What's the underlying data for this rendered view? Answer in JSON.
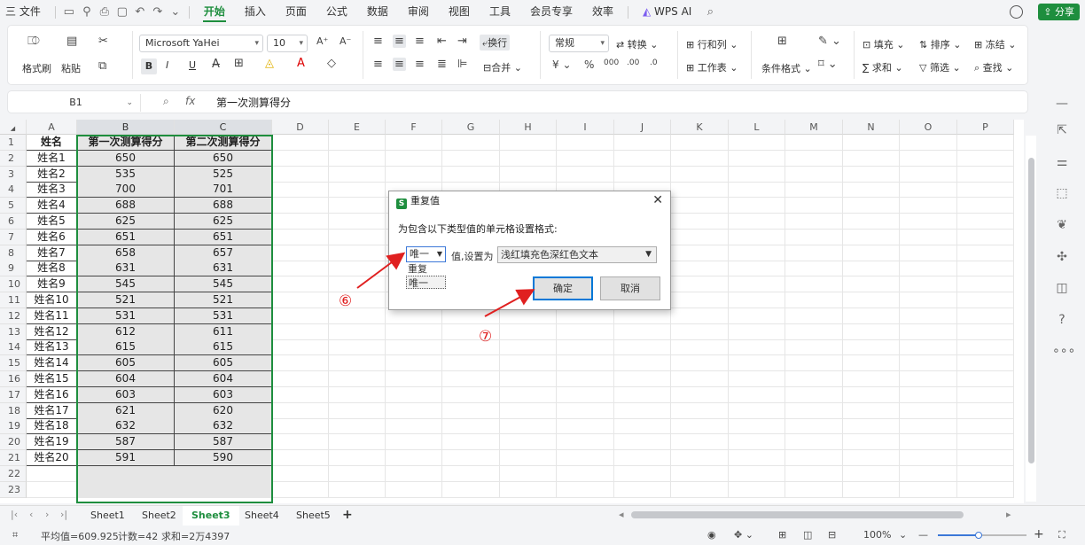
{
  "menu": {
    "items": [
      "三 文件",
      "开始",
      "插入",
      "页面",
      "公式",
      "数据",
      "审阅",
      "视图",
      "工具",
      "会员专享",
      "效率"
    ],
    "active_index": 1,
    "wps_ai": "WPS AI",
    "share": "分享"
  },
  "ribbon": {
    "format_painter": "格式刷",
    "paste": "粘贴",
    "font": "Microsoft YaHei",
    "font_size": "10",
    "bold": "B",
    "italic": "I",
    "underline": "U",
    "wrap": "换行",
    "number_format": "常规",
    "convert": "转换",
    "row_col": "行和列",
    "merge": "合并",
    "worksheet": "工作表",
    "cond_format": "条件格式",
    "fill": "填充",
    "sort": "排序",
    "freeze": "冻结",
    "sum": "求和",
    "filter": "筛选",
    "find": "查找"
  },
  "formula_bar": {
    "name_box": "B1",
    "fx": "fx",
    "content": "第一次测算得分"
  },
  "columns": [
    "A",
    "B",
    "C",
    "D",
    "E",
    "F",
    "G",
    "H",
    "I",
    "J",
    "K",
    "L",
    "M",
    "N",
    "O",
    "P"
  ],
  "rows": [
    [
      "姓名",
      "第一次测算得分",
      "第二次测算得分"
    ],
    [
      "姓名1",
      "650",
      "650"
    ],
    [
      "姓名2",
      "535",
      "525"
    ],
    [
      "姓名3",
      "700",
      "701"
    ],
    [
      "姓名4",
      "688",
      "688"
    ],
    [
      "姓名5",
      "625",
      "625"
    ],
    [
      "姓名6",
      "651",
      "651"
    ],
    [
      "姓名7",
      "658",
      "657"
    ],
    [
      "姓名8",
      "631",
      "631"
    ],
    [
      "姓名9",
      "545",
      "545"
    ],
    [
      "姓名10",
      "521",
      "521"
    ],
    [
      "姓名11",
      "531",
      "531"
    ],
    [
      "姓名12",
      "612",
      "611"
    ],
    [
      "姓名13",
      "615",
      "615"
    ],
    [
      "姓名14",
      "605",
      "605"
    ],
    [
      "姓名15",
      "604",
      "604"
    ],
    [
      "姓名16",
      "603",
      "603"
    ],
    [
      "姓名17",
      "621",
      "620"
    ],
    [
      "姓名18",
      "632",
      "632"
    ],
    [
      "姓名19",
      "587",
      "587"
    ],
    [
      "姓名20",
      "591",
      "590"
    ]
  ],
  "row_count": 23,
  "dialog": {
    "icon": "S",
    "title": "重复值",
    "close": "✕",
    "description": "为包含以下类型值的单元格设置格式:",
    "type_selected": "唯一",
    "type_options": [
      "重复",
      "唯一"
    ],
    "set_as_label": "值,设置为",
    "format_value": "浅红填充色深红色文本",
    "ok": "确定",
    "cancel": "取消"
  },
  "annotations": {
    "step6": "⑥",
    "step7": "⑦",
    "arrow_color": "#e02020"
  },
  "sheet_tabs": [
    "Sheet1",
    "Sheet2",
    "Sheet3",
    "Sheet4",
    "Sheet5"
  ],
  "active_sheet_index": 2,
  "add_sheet": "+",
  "status_bar": {
    "average": "平均值=609.925",
    "count": "计数=42",
    "sum": "求和=2万4397",
    "zoom": "100%"
  },
  "colors": {
    "accent": "#1e8e3e",
    "selection_border": "#1e8e3e"
  }
}
